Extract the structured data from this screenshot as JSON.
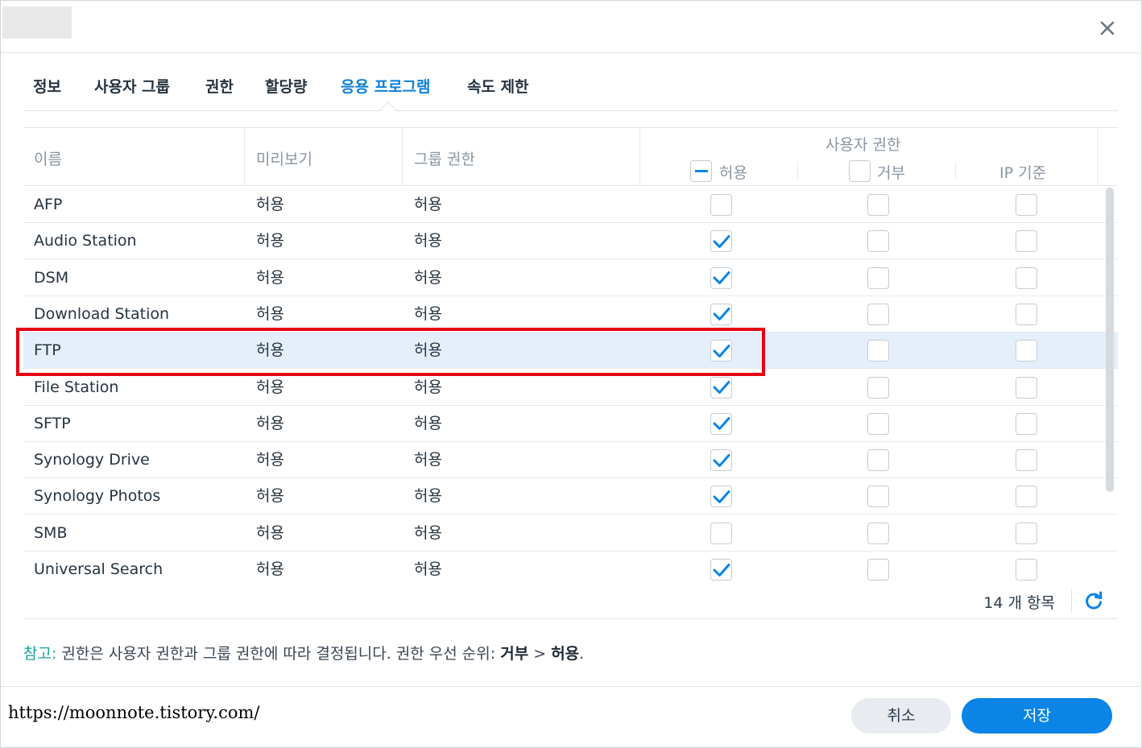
{
  "header": {
    "close_icon": "close-icon"
  },
  "tabs": [
    {
      "label": "정보",
      "active": false
    },
    {
      "label": "사용자 그룹",
      "active": false
    },
    {
      "label": "권한",
      "active": false
    },
    {
      "label": "할당량",
      "active": false
    },
    {
      "label": "응용 프로그램",
      "active": true
    },
    {
      "label": "속도 제한",
      "active": false
    }
  ],
  "grid": {
    "columns": {
      "name": "이름",
      "preview": "미리보기",
      "group_permission": "그룹 권한",
      "user_permission": "사용자 권한",
      "allow": "허용",
      "deny": "거부",
      "ip_based": "IP 기준"
    },
    "rows": [
      {
        "name": "AFP",
        "preview": "허용",
        "group": "허용",
        "allow": false,
        "deny": false,
        "ip": false,
        "selected": false
      },
      {
        "name": "Audio Station",
        "preview": "허용",
        "group": "허용",
        "allow": true,
        "deny": false,
        "ip": false,
        "selected": false
      },
      {
        "name": "DSM",
        "preview": "허용",
        "group": "허용",
        "allow": true,
        "deny": false,
        "ip": false,
        "selected": false
      },
      {
        "name": "Download Station",
        "preview": "허용",
        "group": "허용",
        "allow": true,
        "deny": false,
        "ip": false,
        "selected": false
      },
      {
        "name": "FTP",
        "preview": "허용",
        "group": "허용",
        "allow": true,
        "deny": false,
        "ip": false,
        "selected": true
      },
      {
        "name": "File Station",
        "preview": "허용",
        "group": "허용",
        "allow": true,
        "deny": false,
        "ip": false,
        "selected": false
      },
      {
        "name": "SFTP",
        "preview": "허용",
        "group": "허용",
        "allow": true,
        "deny": false,
        "ip": false,
        "selected": false
      },
      {
        "name": "Synology Drive",
        "preview": "허용",
        "group": "허용",
        "allow": true,
        "deny": false,
        "ip": false,
        "selected": false
      },
      {
        "name": "Synology Photos",
        "preview": "허용",
        "group": "허용",
        "allow": true,
        "deny": false,
        "ip": false,
        "selected": false
      },
      {
        "name": "SMB",
        "preview": "허용",
        "group": "허용",
        "allow": false,
        "deny": false,
        "ip": false,
        "selected": false
      },
      {
        "name": "Universal Search",
        "preview": "허용",
        "group": "허용",
        "allow": true,
        "deny": false,
        "ip": false,
        "selected": false
      }
    ],
    "item_count": "14 개 항목"
  },
  "note": {
    "label": "참고:",
    "text": " 권한은 사용자 권한과 그룹 권한에 따라 결정됩니다. 권한 우선 순위: ",
    "deny": "거부",
    "separator": " > ",
    "allow": "허용",
    "end": "."
  },
  "footer": {
    "url": "https://moonnote.tistory.com/",
    "cancel_label": "취소",
    "save_label": "저장"
  },
  "colors": {
    "accent": "#0a84e6",
    "highlight": "#e60012",
    "selected_row": "#e4effb",
    "note_label": "#16a39a"
  }
}
